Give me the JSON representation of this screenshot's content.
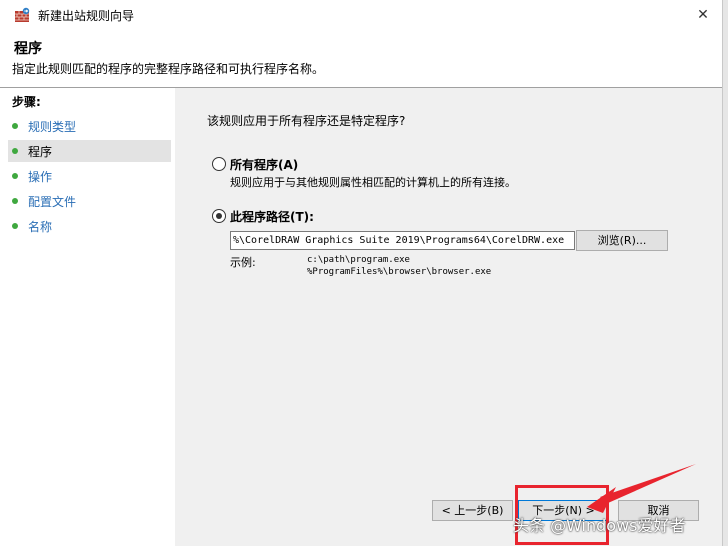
{
  "window": {
    "title": "新建出站规则向导",
    "close_glyph": "✕"
  },
  "header": {
    "title": "程序",
    "description": "指定此规则匹配的程序的完整程序路径和可执行程序名称。"
  },
  "sidebar": {
    "steps_label": "步骤:",
    "items": [
      {
        "label": "规则类型",
        "active": false
      },
      {
        "label": "程序",
        "active": true
      },
      {
        "label": "操作",
        "active": false
      },
      {
        "label": "配置文件",
        "active": false
      },
      {
        "label": "名称",
        "active": false
      }
    ]
  },
  "main": {
    "question": "该规则应用于所有程序还是特定程序?",
    "option_all": {
      "label": "所有程序(A)",
      "description": "规则应用于与其他规则属性相匹配的计算机上的所有连接。",
      "selected": false
    },
    "option_path": {
      "label": "此程序路径(T):",
      "selected": true
    },
    "path_value": "%\\CorelDRAW Graphics Suite 2019\\Programs64\\CorelDRW.exe",
    "browse_label": "浏览(R)...",
    "example_label": "示例:",
    "example_paths": [
      "c:\\path\\program.exe",
      "%ProgramFiles%\\browser\\browser.exe"
    ]
  },
  "footer": {
    "back_label": "< 上一步(B)",
    "next_label": "下一步(N) >",
    "cancel_label": "取消"
  },
  "overlay": {
    "watermark": "头条 @Windows爱好者",
    "annotation_color": "#e8242e"
  }
}
